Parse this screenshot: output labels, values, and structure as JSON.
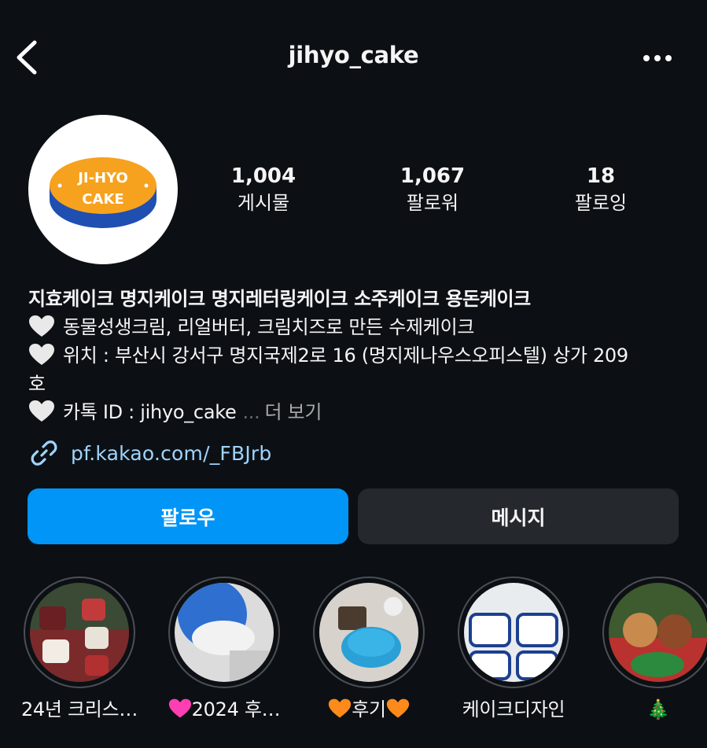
{
  "header": {
    "username": "jihyo_cake",
    "back_icon": "chevron-left-icon",
    "more_icon": "more-horizontal-icon"
  },
  "profile": {
    "avatar_logo_line1": "JI-HYO",
    "avatar_logo_line2": "CAKE",
    "stats": [
      {
        "value": "1,004",
        "label": "게시물"
      },
      {
        "value": "1,067",
        "label": "팔로워"
      },
      {
        "value": "18",
        "label": "팔로잉"
      }
    ]
  },
  "bio": {
    "name": "지효케이크 명지케이크 명지레터링케이크 소주케이크 용돈케이크",
    "lines": [
      "동물성생크림, 리얼버터, 크림치즈로 만든 수제케이크",
      "위치 : 부산시 강서구 명지국제2로 16 (명지제나우스오피스텔) 상가 209",
      "호",
      "카톡 ID : jihyo_cake"
    ],
    "ellipsis": "...",
    "more_label": "더 보기",
    "link": "pf.kakao.com/_FBJrb"
  },
  "buttons": {
    "follow": "팔로우",
    "message": "메시지"
  },
  "highlights": [
    {
      "label": "24년 크리스…"
    },
    {
      "label": "2024 후…"
    },
    {
      "label": "후기"
    },
    {
      "label": "케이크디자인"
    },
    {
      "label": "🎄"
    }
  ],
  "colors": {
    "background": "#0c1014",
    "follow_button": "#0095f6",
    "message_button": "#25292e",
    "link": "#9fd4ff",
    "logo_orange": "#f6a21e",
    "logo_blue": "#1f4fb0"
  }
}
